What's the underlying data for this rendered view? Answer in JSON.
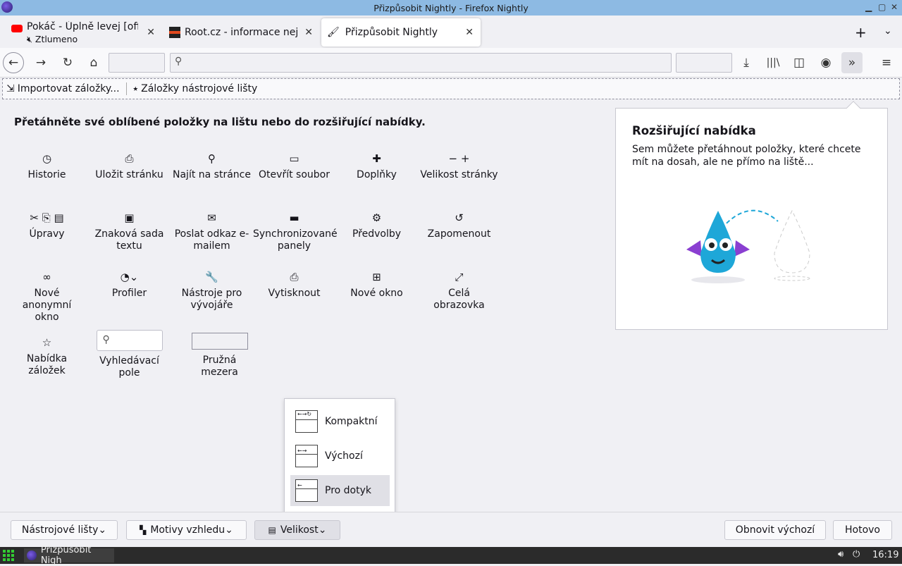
{
  "window": {
    "title": "Přizpůsobit Nightly - Firefox Nightly"
  },
  "tabs": [
    {
      "label": "Pokáč - Úplně levej [offi",
      "sub": "Ztlumeno"
    },
    {
      "label": "Root.cz - informace nejen"
    },
    {
      "label": "Přizpůsobit Nightly"
    }
  ],
  "bookmarks": {
    "import": "Importovat záložky...",
    "toolbar": "Záložky nástrojové lišty"
  },
  "heading": "Přetáhněte své oblíbené položky na lištu nebo do rozšiřující nabídky.",
  "palette": [
    {
      "label": "Historie",
      "icon": "◷"
    },
    {
      "label": "Uložit stránku",
      "icon": "⎙"
    },
    {
      "label": "Najít na stránce",
      "icon": "⚲"
    },
    {
      "label": "Otevřít soubor",
      "icon": "▭"
    },
    {
      "label": "Doplňky",
      "icon": "✚"
    },
    {
      "label": "Velikost stránky",
      "icon": "− +"
    },
    {
      "label": "Úpravy",
      "icon": "✂ ⎘ ▤"
    },
    {
      "label": "Znaková sada textu",
      "icon": "▣"
    },
    {
      "label": "Poslat odkaz e-mailem",
      "icon": "✉"
    },
    {
      "label": "Synchronizované panely",
      "icon": "▬"
    },
    {
      "label": "Předvolby",
      "icon": "⚙"
    },
    {
      "label": "Zapomenout",
      "icon": "↺"
    },
    {
      "label": "Nové anonymní okno",
      "icon": "∞"
    },
    {
      "label": "Profiler",
      "icon": "◔⌄"
    },
    {
      "label": "Nástroje pro vývojáře",
      "icon": "🔧"
    },
    {
      "label": "Vytisknout",
      "icon": "⎙"
    },
    {
      "label": "Nové okno",
      "icon": "⊞"
    },
    {
      "label": "Celá obrazovka",
      "icon": "⤢"
    },
    {
      "label": "Nabídka záložek",
      "icon": "☆"
    },
    {
      "label": "Vyhledávací pole",
      "icon": ""
    },
    {
      "label": "Pružná mezera",
      "icon": ""
    }
  ],
  "overflow": {
    "title": "Rozšiřující nabídka",
    "description": "Sem můžete přetáhnout položky, které chcete mít na dosah, ale ne přímo na liště..."
  },
  "density": [
    {
      "label": "Kompaktní",
      "selected": false
    },
    {
      "label": "Výchozí",
      "selected": false
    },
    {
      "label": "Pro dotyk",
      "selected": true
    }
  ],
  "footer": {
    "toolbars": "Nástrojové lišty",
    "themes": "Motivy vzhledu",
    "density": "Velikost",
    "restore": "Obnovit výchozí",
    "done": "Hotovo"
  },
  "taskbar": {
    "task": "Přizpůsobit Nigh",
    "clock": "16:19"
  }
}
